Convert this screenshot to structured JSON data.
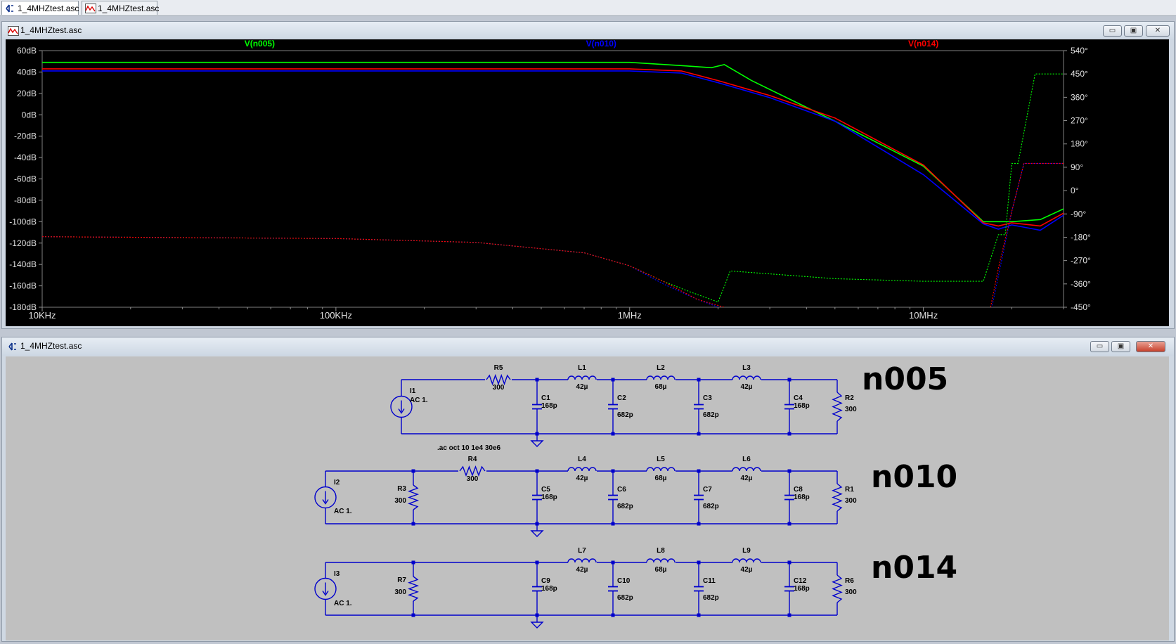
{
  "tabs": [
    {
      "label": "1_4MHZtest.asc",
      "icon": "schematic-icon"
    },
    {
      "label": "1_4MHZtest.asc",
      "icon": "waveform-icon"
    }
  ],
  "plot_window": {
    "title": "1_4MHZtest.asc",
    "icon": "waveform-icon"
  },
  "schematic_window": {
    "title": "1_4MHZtest.asc",
    "icon": "schematic-icon"
  },
  "window_buttons": {
    "minimize": "▭",
    "restore": "▣",
    "close": "✕"
  },
  "colors": {
    "n005": "#00ff00",
    "n010": "#0000ff",
    "n014": "#ff0000",
    "yellow_overlay": "#ffff00",
    "plot_bg": "#000000",
    "schematic_bg": "#c0c0c0",
    "wire": "#0000cc"
  },
  "chart_data": {
    "type": "line",
    "x_scale": "log",
    "xlim": [
      10000,
      30000000
    ],
    "x_tick_labels": [
      "10KHz",
      "100KHz",
      "1MHz",
      "10MHz"
    ],
    "left_axis": {
      "unit": "dB",
      "ylim": [
        -180,
        60
      ],
      "tick_labels": [
        "60dB",
        "40dB",
        "20dB",
        "0dB",
        "-20dB",
        "-40dB",
        "-60dB",
        "-80dB",
        "-100dB",
        "-120dB",
        "-140dB",
        "-160dB",
        "-180dB"
      ]
    },
    "right_axis": {
      "unit": "°",
      "ylim": [
        -450,
        540
      ],
      "tick_labels": [
        "540°",
        "450°",
        "360°",
        "270°",
        "180°",
        "90°",
        "0°",
        "-90°",
        "-180°",
        "-270°",
        "-360°",
        "-450°"
      ]
    },
    "legend": [
      "V(n005)",
      "V(n010)",
      "V(n014)"
    ],
    "series": [
      {
        "name": "V(n005)",
        "kind": "magnitude",
        "x": [
          10000,
          1000000,
          1500000,
          1900000,
          2100000,
          2600000,
          5000000,
          10000000,
          16000000,
          20000000,
          25000000,
          30000000
        ],
        "y": [
          49,
          49,
          46,
          44,
          47,
          32,
          -6,
          -48,
          -100,
          -100,
          -98,
          -88
        ]
      },
      {
        "name": "V(n010)",
        "kind": "magnitude",
        "x": [
          10000,
          1000000,
          1500000,
          2000000,
          3000000,
          5000000,
          10000000,
          16000000,
          18000000,
          20000000,
          25000000,
          30000000
        ],
        "y": [
          41,
          41,
          39,
          30,
          16,
          -6,
          -56,
          -102,
          -107,
          -103,
          -108,
          -94
        ]
      },
      {
        "name": "V(n014)",
        "kind": "magnitude",
        "x": [
          10000,
          1000000,
          1500000,
          2000000,
          3000000,
          5000000,
          10000000,
          16000000,
          18000000,
          20000000,
          25000000,
          30000000
        ],
        "y": [
          43,
          43,
          41,
          32,
          18,
          -3,
          -47,
          -101,
          -104,
          -101,
          -104,
          -92
        ]
      },
      {
        "name": "V(n005)",
        "kind": "phase",
        "x": [
          10000,
          100000,
          300000,
          700000,
          1000000,
          1300000,
          1600000,
          2000000,
          2100000,
          2200000,
          5000000,
          10000000,
          16000000,
          18000000,
          19000000,
          20000000,
          21000000,
          24000000,
          30000000
        ],
        "y": [
          -178,
          -185,
          -200,
          -240,
          -290,
          -350,
          -390,
          -430,
          -370,
          -310,
          -340,
          -350,
          -350,
          -170,
          -170,
          105,
          105,
          450,
          450
        ]
      },
      {
        "name": "V(n010)",
        "kind": "phase",
        "x": [
          10000,
          100000,
          300000,
          700000,
          1000000,
          1300000,
          1700000,
          2500000,
          5000000,
          10000000,
          16000000,
          20000000,
          22000000,
          30000000
        ],
        "y": [
          -178,
          -185,
          -200,
          -240,
          -290,
          -360,
          -420,
          -490,
          -540,
          -580,
          -610,
          -80,
          105,
          105
        ]
      },
      {
        "name": "V(n014)",
        "kind": "phase",
        "x": [
          10000,
          100000,
          300000,
          700000,
          1000000,
          1300000,
          1700000,
          2500000,
          5000000,
          10000000,
          16000000,
          18000000,
          20000000,
          22000000,
          30000000
        ],
        "y": [
          -178,
          -185,
          -200,
          -240,
          -290,
          -350,
          -420,
          -475,
          -525,
          -560,
          -590,
          -300,
          -80,
          105,
          105
        ]
      }
    ]
  },
  "schematic": {
    "directive": ".ac oct 10 1e4 30e6",
    "net_labels": [
      "n005",
      "n010",
      "n014"
    ],
    "circuit1": {
      "source": {
        "ref": "I1",
        "value": "AC 1."
      },
      "resistors": [
        {
          "ref": "R5",
          "value": "300"
        },
        {
          "ref": "R2",
          "value": "300"
        }
      ],
      "inductors": [
        {
          "ref": "L1",
          "value": "42µ"
        },
        {
          "ref": "L2",
          "value": "68µ"
        },
        {
          "ref": "L3",
          "value": "42µ"
        }
      ],
      "capacitors": [
        {
          "ref": "C1",
          "value": "168p"
        },
        {
          "ref": "C2",
          "value": "682p"
        },
        {
          "ref": "C3",
          "value": "682p"
        },
        {
          "ref": "C4",
          "value": "168p"
        }
      ]
    },
    "circuit2": {
      "source": {
        "ref": "I2",
        "value": "AC 1."
      },
      "resistors": [
        {
          "ref": "R3",
          "value": "300"
        },
        {
          "ref": "R4",
          "value": "300"
        },
        {
          "ref": "R1",
          "value": "300"
        }
      ],
      "inductors": [
        {
          "ref": "L4",
          "value": "42µ"
        },
        {
          "ref": "L5",
          "value": "68µ"
        },
        {
          "ref": "L6",
          "value": "42µ"
        }
      ],
      "capacitors": [
        {
          "ref": "C5",
          "value": "168p"
        },
        {
          "ref": "C6",
          "value": "682p"
        },
        {
          "ref": "C7",
          "value": "682p"
        },
        {
          "ref": "C8",
          "value": "168p"
        }
      ]
    },
    "circuit3": {
      "source": {
        "ref": "I3",
        "value": "AC 1."
      },
      "resistors": [
        {
          "ref": "R7",
          "value": "300"
        },
        {
          "ref": "R6",
          "value": "300"
        }
      ],
      "inductors": [
        {
          "ref": "L7",
          "value": "42µ"
        },
        {
          "ref": "L8",
          "value": "68µ"
        },
        {
          "ref": "L9",
          "value": "42µ"
        }
      ],
      "capacitors": [
        {
          "ref": "C9",
          "value": "168p"
        },
        {
          "ref": "C10",
          "value": "682p"
        },
        {
          "ref": "C11",
          "value": "682p"
        },
        {
          "ref": "C12",
          "value": "168p"
        }
      ]
    }
  }
}
